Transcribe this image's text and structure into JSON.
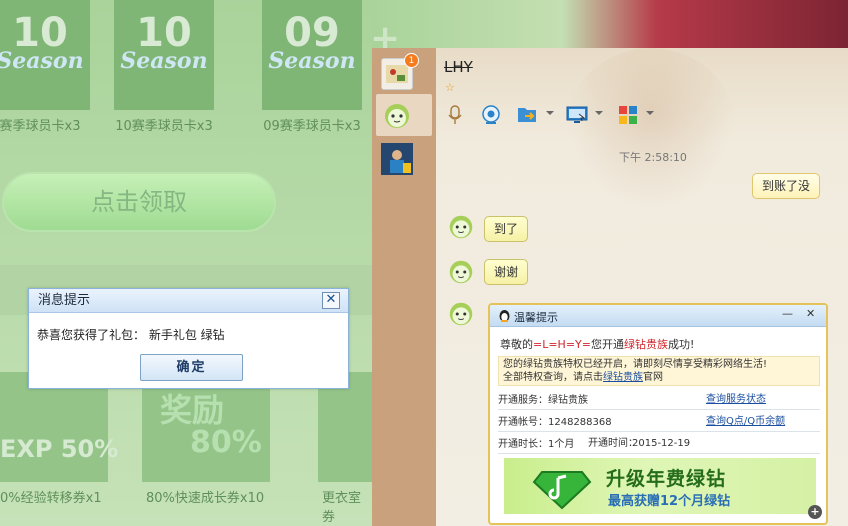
{
  "game": {
    "cards": [
      {
        "num": "10",
        "season": "Season",
        "label": "赛季球员卡x3"
      },
      {
        "num": "10",
        "season": "Season",
        "label": "10赛季球员卡x3"
      },
      {
        "num": "09",
        "season": "Season",
        "label": "09赛季球员卡x3"
      }
    ],
    "claim_label": "点击领取",
    "gifts": [
      {
        "label": "0%经验转移券x1",
        "text": "EXP 50%"
      },
      {
        "label": "80%快速成长券x10",
        "text": "奖励",
        "text2": "80%"
      },
      {
        "label": "更衣室券"
      }
    ]
  },
  "dialog": {
    "title": "消息提示",
    "close": "✕",
    "message": "恭喜您获得了礼包：  新手礼包 绿钻",
    "ok": "确定"
  },
  "chat": {
    "badge_count": "1",
    "contact_name": "LHY",
    "star": "☆",
    "timestamp": "下午 2:58:10",
    "messages": [
      {
        "side": "right",
        "text": "到账了没"
      },
      {
        "side": "left",
        "text": "到了"
      },
      {
        "side": "left",
        "text": "谢谢"
      }
    ]
  },
  "notice": {
    "title": "温馨提示",
    "min": "—",
    "close": "✕",
    "line1_prefix": "尊敬的",
    "line1_name": "=L=H=Y=",
    "line1_mid": "您开通",
    "line1_service": "绿钻贵族",
    "line1_suffix": "成功!",
    "line2a": "您的绿钻贵族特权已经开启，请即刻尽情享受精彩网络生活!",
    "line2b_prefix": "全部特权查询，请点击",
    "line2b_link": "绿钻贵族",
    "line2b_suffix": "官网",
    "row_service_label": "开通服务：绿钻贵族",
    "row_service_link": "查询服务状态",
    "row_account_label": "开通帐号：",
    "row_account_value": "1248288368",
    "row_account_link": "查询Q点/Q币余额",
    "row_duration": "开通时长：1个月",
    "row_time_label": "开通时间：",
    "row_time_value": "2015-12-19",
    "promo_line1": "升级年费绿钻",
    "promo_line2": "最高获赠12个月绿钻"
  },
  "colors": {
    "accent_red": "#d0262b",
    "link_blue": "#1a4e9f",
    "bubble_border": "#e0c66d"
  }
}
